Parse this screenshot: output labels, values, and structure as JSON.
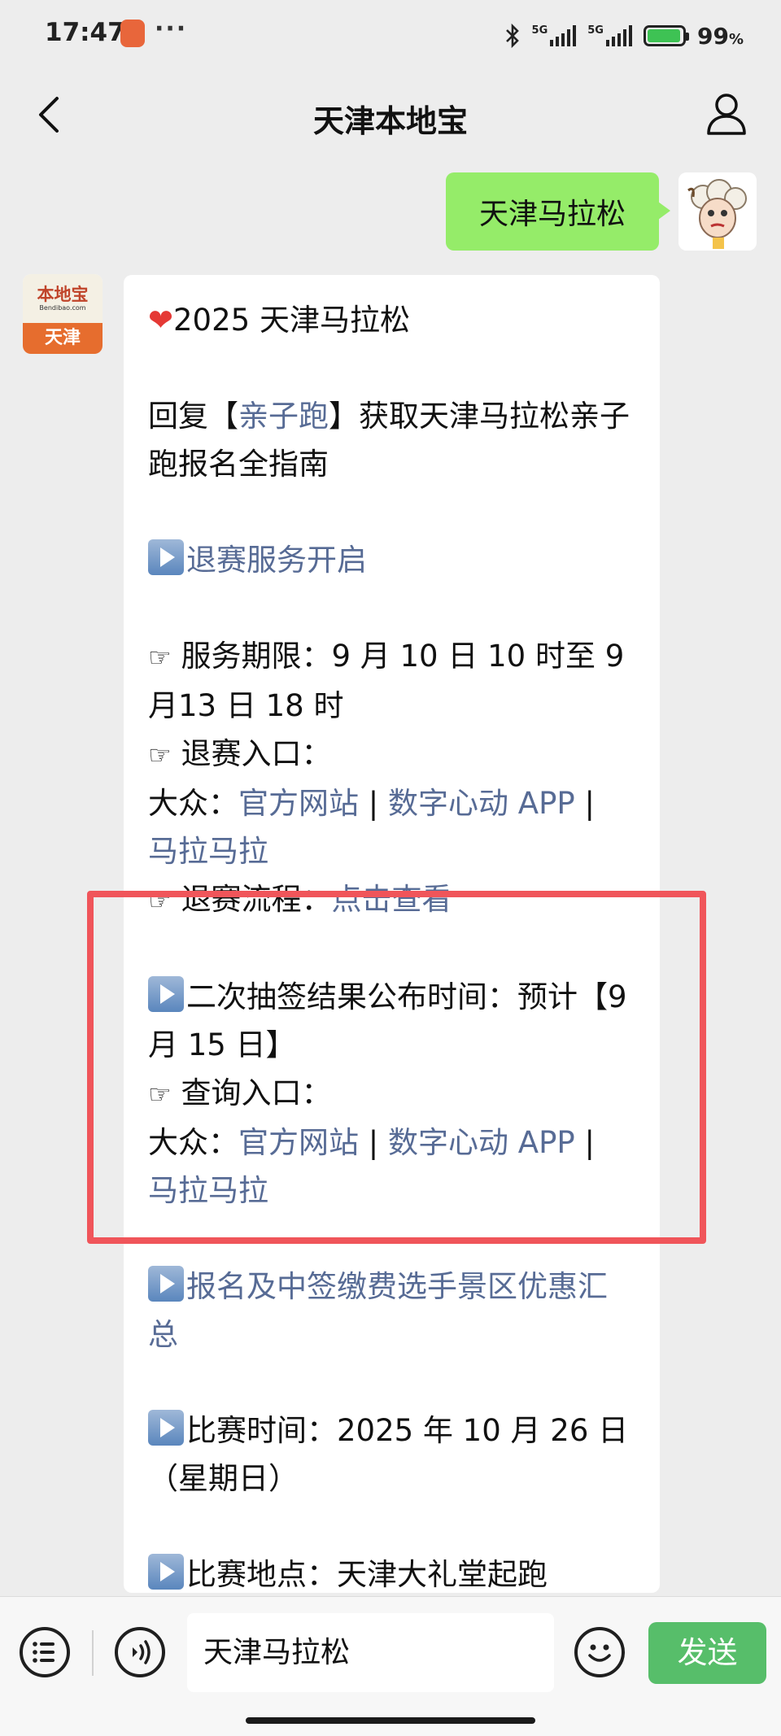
{
  "status_bar": {
    "time": "17:47",
    "more": "···",
    "network_1": "5G",
    "network_2": "5G",
    "battery": "99",
    "battery_unit": "%"
  },
  "nav": {
    "title": "天津本地宝"
  },
  "chat": {
    "user_message": "天津马拉松",
    "bot_avatar": {
      "logo": "本地宝",
      "url": "Bendibao.com",
      "city": "天津"
    },
    "reply": {
      "heading": "2025 天津马拉松",
      "reply_prefix": "回复【",
      "reply_keyword": "亲子跑",
      "reply_suffix": "】获取天津马拉松亲子跑报名全指南",
      "refund_title": "退赛服务开启",
      "service_period": "服务期限：9 月 10 日 10 时至 9 月13 日 18 时",
      "refund_entry_label": "退赛入口：",
      "public_label": "大众：",
      "link_official_site": "官方网站",
      "separator": "|",
      "link_app": "数字心动 APP",
      "link_malamala": "马拉马拉",
      "refund_process_label": "退赛流程：",
      "link_view": "点击查看",
      "draw_result": "二次抽签结果公布时间：预计【9 月 15 日】",
      "query_entry_label": "查询入口：",
      "discount_title": "报名及中签缴费选手景区优惠汇总",
      "race_time": "比赛时间：2025 年 10 月 26 日（星期日）",
      "race_location": "比赛地点：天津大礼堂起跑"
    }
  },
  "input_bar": {
    "value": "天津马拉松",
    "send_label": "发送"
  },
  "colors": {
    "link": "#576b95",
    "outgoing_bubble": "#95ec69",
    "send_button": "#57be6a",
    "highlight_box": "#f0555a"
  }
}
